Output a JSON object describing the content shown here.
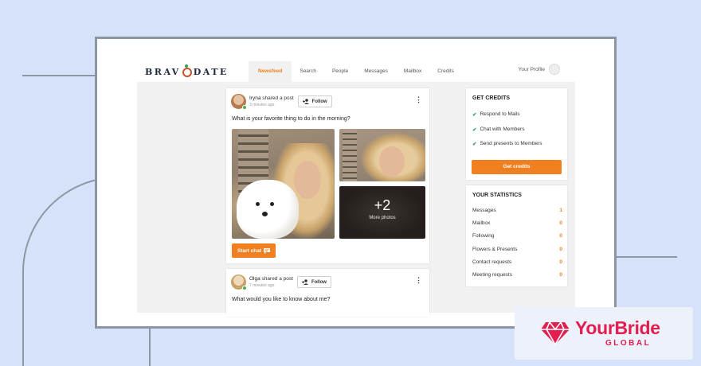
{
  "app": {
    "logo_left": "BRAV",
    "logo_right": "DATE"
  },
  "nav": {
    "tabs": [
      {
        "label": "Newsfeed",
        "active": true
      },
      {
        "label": "Search"
      },
      {
        "label": "People"
      },
      {
        "label": "Messages"
      },
      {
        "label": "Mailbox"
      },
      {
        "label": "Credits"
      }
    ],
    "profile_label": "Your Profile"
  },
  "feed": {
    "posts": [
      {
        "author": "Iryna",
        "action": "shared a post",
        "time": "3 minutes ago",
        "follow_label": "Follow",
        "question": "What is your favorite thing to do in the morning?",
        "more_count": "+2",
        "more_label": "More photos",
        "chat_label": "Start chat"
      },
      {
        "author": "Olga",
        "action": "shared a post",
        "time": "7 minutes ago",
        "follow_label": "Follow",
        "question": "What would you like to know about me?"
      }
    ]
  },
  "credits_panel": {
    "title": "GET CREDITS",
    "items": [
      "Respond to Mails",
      "Chat with Members",
      "Send presents to Members"
    ],
    "button_label": "Get credits"
  },
  "stats_panel": {
    "title": "YOUR STATISTICS",
    "rows": [
      {
        "label": "Messages",
        "value": "1"
      },
      {
        "label": "Mailbox",
        "value": "0"
      },
      {
        "label": "Following",
        "value": "0"
      },
      {
        "label": "Flowers & Presents",
        "value": "0"
      },
      {
        "label": "Contact requests",
        "value": "0"
      },
      {
        "label": "Meeting requests",
        "value": "0"
      }
    ]
  },
  "badge": {
    "brand": "YourBride",
    "sub": "GLOBAL"
  },
  "colors": {
    "accent": "#f07f1f",
    "brand_red": "#e21d4f",
    "check_green": "#3aa05a",
    "background": "#d6e2fa"
  }
}
